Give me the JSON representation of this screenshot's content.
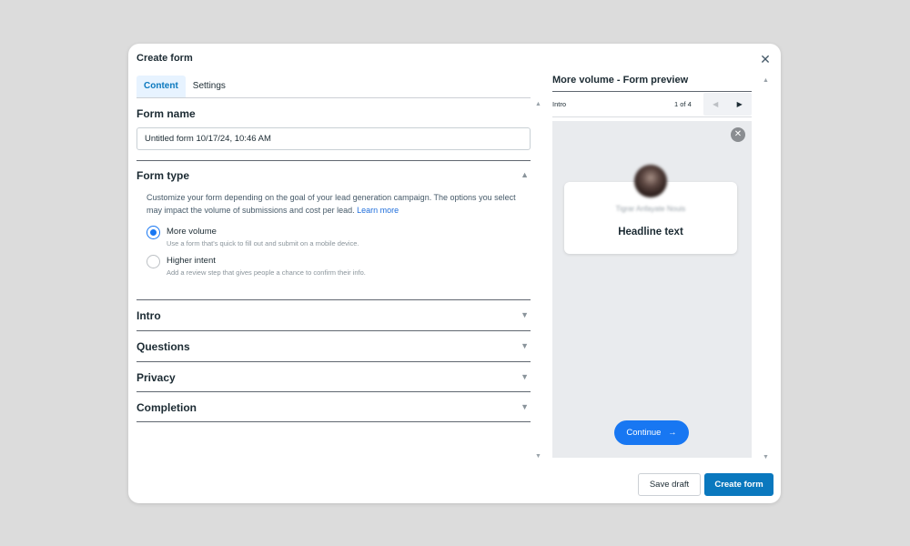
{
  "modal": {
    "title": "Create form",
    "close_glyph": "✕"
  },
  "tabs": [
    {
      "label": "Content",
      "active": true
    },
    {
      "label": "Settings",
      "active": false
    }
  ],
  "form_name": {
    "title": "Form name",
    "value": "Untitled form 10/17/24, 10:46 AM"
  },
  "form_type": {
    "title": "Form type",
    "description": "Customize your form depending on the goal of your lead generation campaign. The options you select may impact the volume of submissions and cost per lead.",
    "learn_more": "Learn more",
    "options": [
      {
        "label": "More volume",
        "sub": "Use a form that's quick to fill out and submit on a mobile device.",
        "checked": true
      },
      {
        "label": "Higher intent",
        "sub": "Add a review step that gives people a chance to confirm their info.",
        "checked": false
      }
    ]
  },
  "sections": [
    {
      "title": "Intro"
    },
    {
      "title": "Questions"
    },
    {
      "title": "Privacy"
    },
    {
      "title": "Completion"
    }
  ],
  "preview": {
    "title": "More volume - Form preview",
    "step_label": "Intro",
    "page_count": "1 of 4",
    "page_name": "Tigrar Anfayate Nouis",
    "headline": "Headline text",
    "continue_label": "Continue",
    "continue_arrow": "→"
  },
  "footer": {
    "save_draft": "Save draft",
    "create_form": "Create form"
  },
  "colors": {
    "accent": "#0a78be",
    "primary_button": "#1877f2",
    "tab_active_bg": "#e7f3ff"
  }
}
